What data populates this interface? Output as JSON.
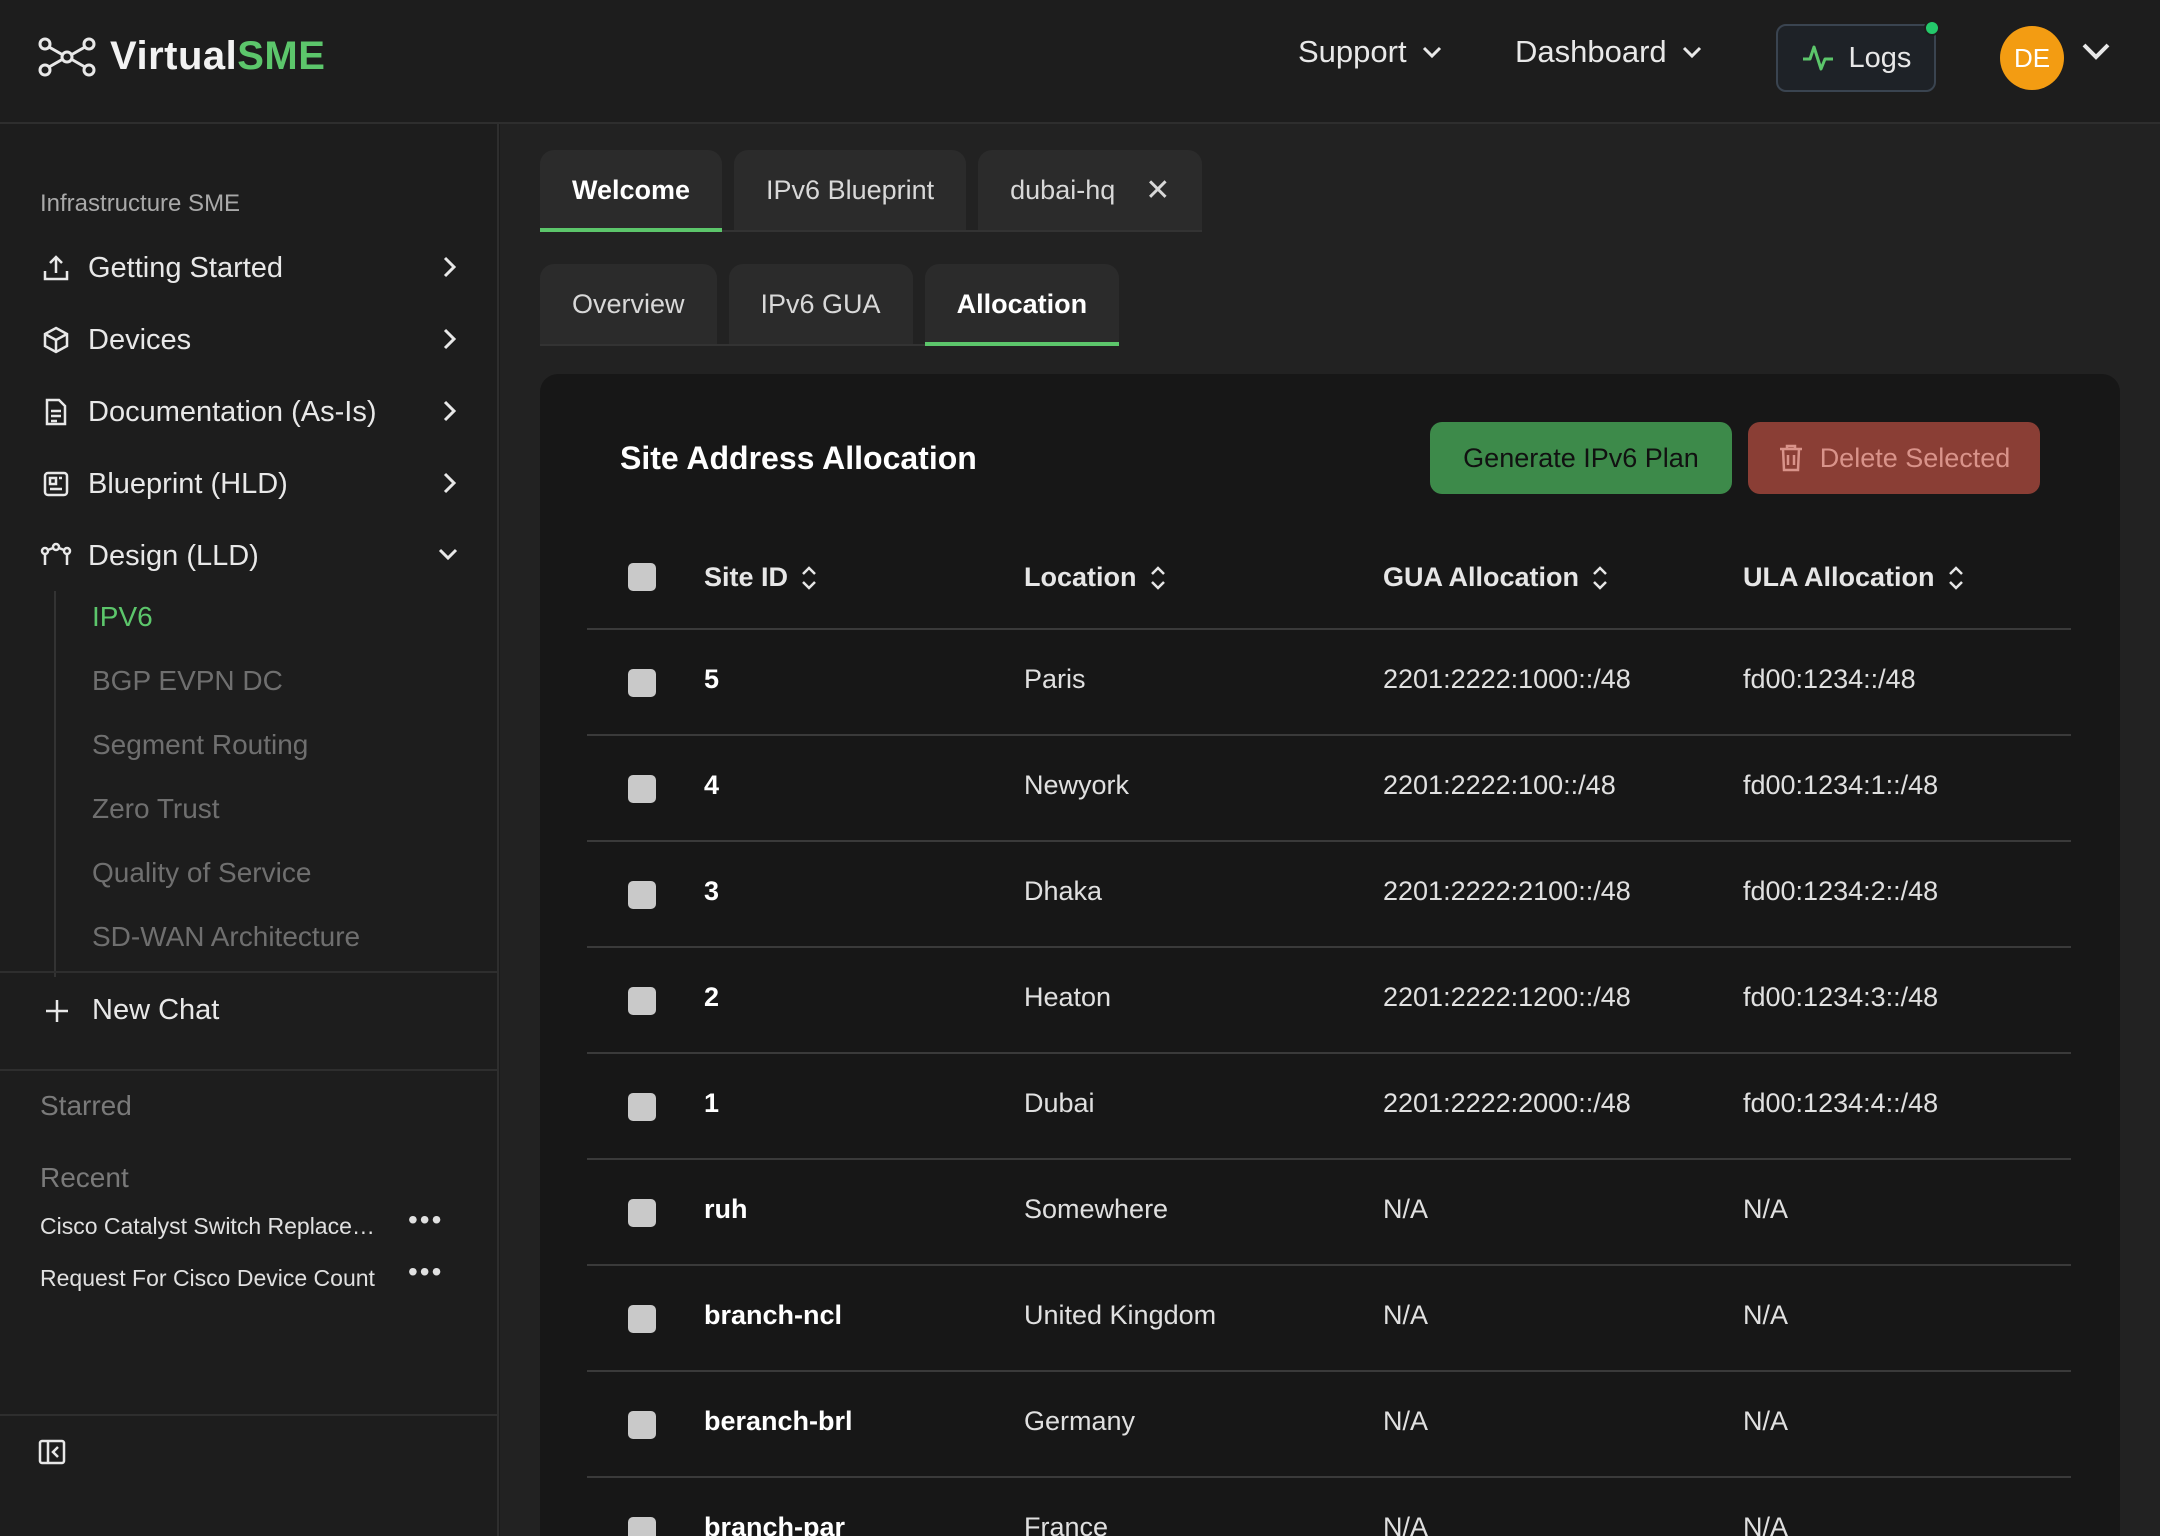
{
  "header": {
    "logo_main": "Virtual",
    "logo_accent": "SME",
    "nav_support": "Support",
    "nav_dashboard": "Dashboard",
    "logs_label": "Logs",
    "avatar_initials": "DE",
    "accent_color": "#5cc66b",
    "avatar_color": "#f39c12",
    "status_dot_color": "#24c96b"
  },
  "sidebar": {
    "section_label": "Infrastructure SME",
    "items": [
      {
        "label": "Getting Started",
        "icon": "upload-icon"
      },
      {
        "label": "Devices",
        "icon": "box-icon"
      },
      {
        "label": "Documentation (As-Is)",
        "icon": "document-icon"
      },
      {
        "label": "Blueprint (HLD)",
        "icon": "blueprint-icon"
      },
      {
        "label": "Design (LLD)",
        "icon": "design-icon"
      }
    ],
    "sub_items": [
      "IPV6",
      "BGP EVPN DC",
      "Segment Routing",
      "Zero Trust",
      "Quality of Service",
      "SD-WAN Architecture"
    ],
    "new_chat_label": "New Chat",
    "starred_label": "Starred",
    "recent_label": "Recent",
    "recent_items": [
      "Cisco Catalyst Switch Replacement",
      "Request For Cisco Device Count"
    ]
  },
  "main": {
    "tabs": [
      {
        "label": "Welcome"
      },
      {
        "label": "IPv6 Blueprint"
      },
      {
        "label": "dubai-hq"
      }
    ],
    "sub_tabs": [
      {
        "label": "Overview"
      },
      {
        "label": "IPv6 GUA"
      },
      {
        "label": "Allocation"
      }
    ],
    "panel_title": "Site Address Allocation",
    "generate_label": "Generate IPv6 Plan",
    "delete_label": "Delete Selected",
    "columns": [
      "Site ID",
      "Location",
      "GUA Allocation",
      "ULA Allocation"
    ],
    "rows": [
      {
        "id": "5",
        "location": "Paris",
        "gua": "2201:2222:1000::/48",
        "ula": "fd00:1234::/48"
      },
      {
        "id": "4",
        "location": "Newyork",
        "gua": "2201:2222:100::/48",
        "ula": "fd00:1234:1::/48"
      },
      {
        "id": "3",
        "location": "Dhaka",
        "gua": "2201:2222:2100::/48",
        "ula": "fd00:1234:2::/48"
      },
      {
        "id": "2",
        "location": "Heaton",
        "gua": "2201:2222:1200::/48",
        "ula": "fd00:1234:3::/48"
      },
      {
        "id": "1",
        "location": "Dubai",
        "gua": "2201:2222:2000::/48",
        "ula": "fd00:1234:4::/48"
      },
      {
        "id": "ruh",
        "location": "Somewhere",
        "gua": "N/A",
        "ula": "N/A"
      },
      {
        "id": "branch-ncl",
        "location": "United Kingdom",
        "gua": "N/A",
        "ula": "N/A"
      },
      {
        "id": "beranch-brl",
        "location": "Germany",
        "gua": "N/A",
        "ula": "N/A"
      },
      {
        "id": "branch-par",
        "location": "France",
        "gua": "N/A",
        "ula": "N/A"
      }
    ]
  }
}
